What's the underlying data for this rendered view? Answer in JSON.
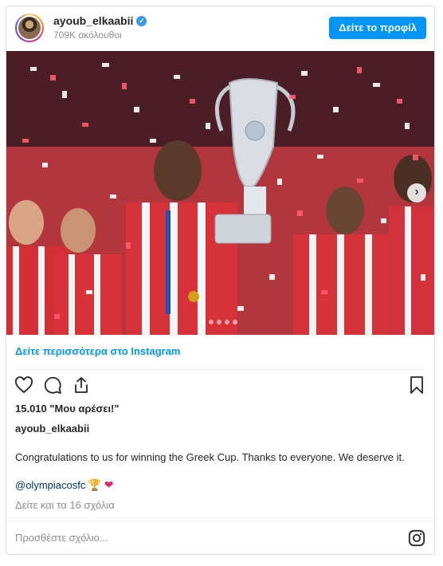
{
  "header": {
    "username": "ayoub_elkaabii",
    "followers": "709K ακόλουθοι",
    "profile_button": "Δείτε το προφίλ"
  },
  "post": {
    "view_more": "Δείτε περισσότερα στο Instagram",
    "likes": "15.010 \"Μου αρέσει!\"",
    "author": "ayoub_elkaabii",
    "caption": "Congratulations to us for winning the Greek Cup. Thanks to everyone. We deserve it.",
    "mention": "@olympiacosfc",
    "comments_link": "Δείτε και τα 16 σχόλια",
    "comment_placeholder": "Προσθέστε σχόλιο...",
    "carousel_count": 5,
    "carousel_active": 1
  },
  "icons": [
    "verified-icon",
    "chevron-right-icon",
    "heart-icon",
    "comment-icon",
    "share-icon",
    "bookmark-icon",
    "instagram-icon"
  ],
  "colors": {
    "accent": "#0095f6",
    "text": "#262626",
    "muted": "#8e8e8e",
    "link": "#00376b"
  }
}
